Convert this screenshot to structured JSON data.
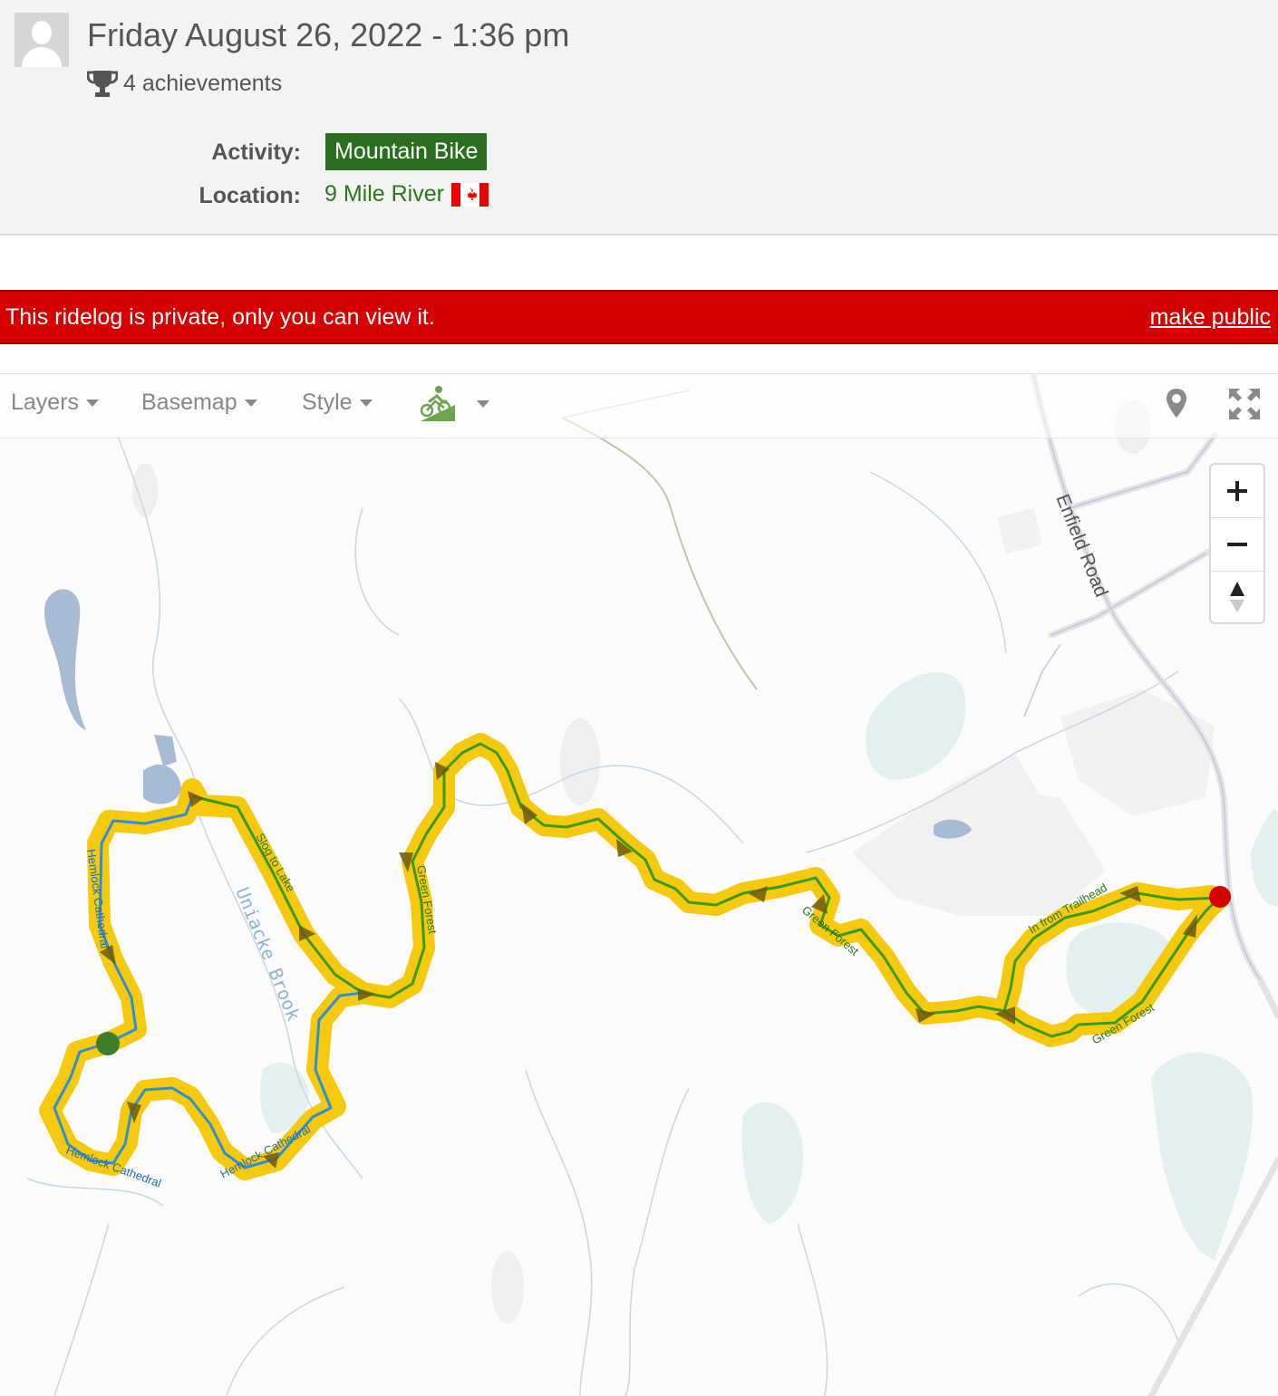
{
  "header": {
    "title": "Friday August 26, 2022 - 1:36 pm",
    "achievements": "4 achievements",
    "activity_label": "Activity:",
    "activity_value": "Mountain Bike",
    "location_label": "Location:",
    "location_value": "9 Mile River",
    "location_flag": "canada-flag-icon"
  },
  "banner": {
    "message": "This ridelog is private, only you can view it.",
    "link": "make public"
  },
  "map_toolbar": {
    "layers": "Layers",
    "basemap": "Basemap",
    "style": "Style"
  },
  "map_labels": {
    "road": "Enfield Road",
    "brook": "Uniacke Brook",
    "trail_slog": "Slog to Lake",
    "trail_green_1": "Green Forest",
    "trail_green_2": "Green Forest",
    "trail_green_3": "Green Forest",
    "trail_hemlock_1": "Hemlock Cathedral",
    "trail_hemlock_2": "Hemlock Cathedral",
    "trail_hemlock_3": "Hemlock Cathedral",
    "trail_trailhead": "In from Trailhead"
  },
  "colors": {
    "banner": "#d60000",
    "activity_badge": "#2b6e1f",
    "route_highlight": "#f7c600",
    "trail_green": "#3a9a1d",
    "trail_blue": "#2d8fd5",
    "start_marker": "#3e7d2a",
    "end_marker": "#d40000"
  }
}
